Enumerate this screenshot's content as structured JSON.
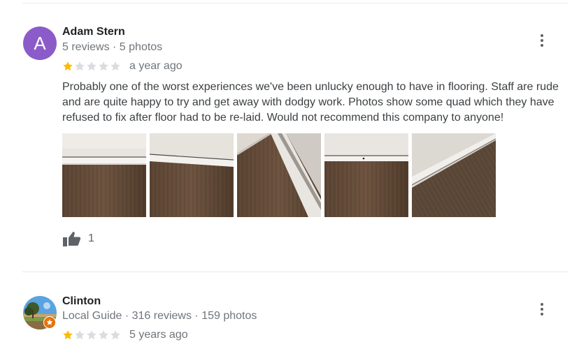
{
  "reviews": [
    {
      "avatar_letter": "A",
      "avatar_color": "#8b5cc9",
      "name": "Adam Stern",
      "meta": "5 reviews · 5 photos",
      "rating": 1,
      "max_rating": 5,
      "time": "a year ago",
      "text": "Probably one of the worst experiences we've been unlucky enough to have in flooring. Staff are rude and are quite happy to try and get away with dodgy work. Photos show some quad which they have refused to fix after floor had to be re-laid. Would not recommend this company to anyone!",
      "photos_count": 5,
      "likes": "1"
    },
    {
      "name": "Clinton",
      "meta": "Local Guide · 316 reviews · 159 photos",
      "rating": 1,
      "max_rating": 5,
      "time": "5 years ago"
    }
  ],
  "colors": {
    "star_filled": "#fbbc04",
    "star_empty": "#dadce0",
    "local_guide_badge": "#e8710a"
  },
  "icons": {
    "menu": "more-vert-icon",
    "like": "thumb-up-icon",
    "star": "star-icon"
  }
}
